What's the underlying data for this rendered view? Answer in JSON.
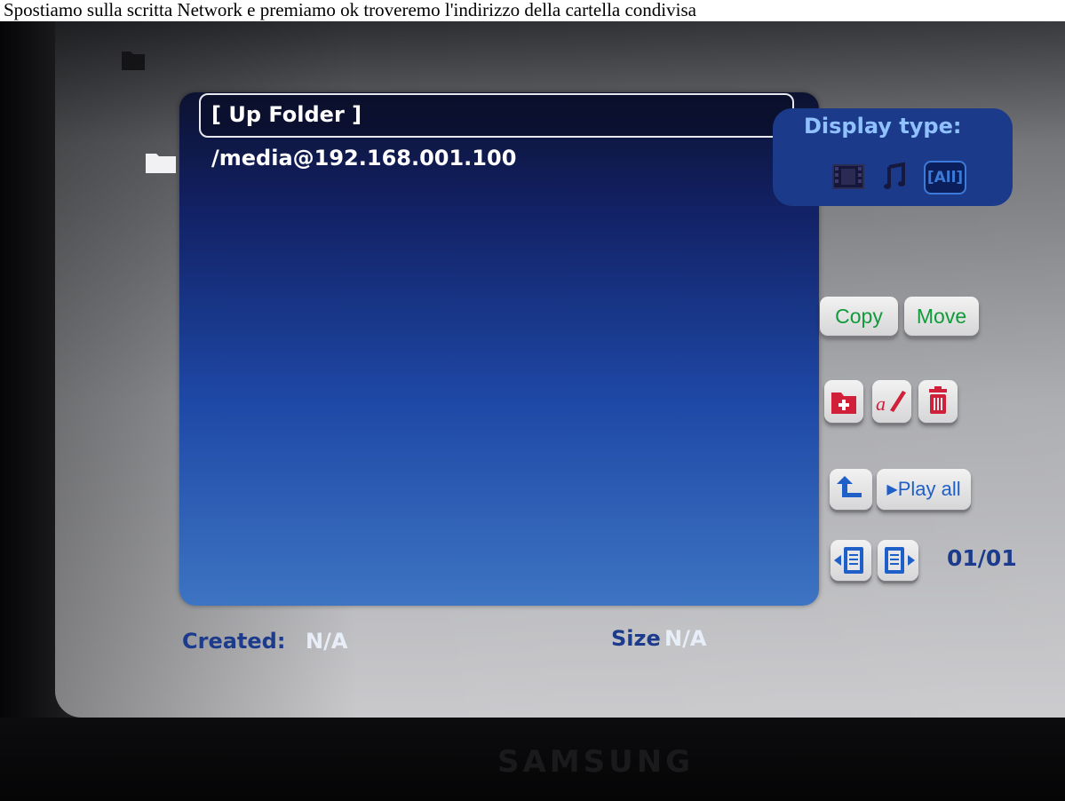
{
  "caption": "Spostiamo sulla scritta Network e premiamo ok troveremo l'indirizzo della cartella condivisa",
  "file_list": {
    "items": [
      {
        "label": "[ Up Folder ]",
        "selected": true
      },
      {
        "label": "/media@192.168.001.100",
        "icon": "folder-icon"
      }
    ]
  },
  "display_type": {
    "title": "Display type:",
    "options": [
      {
        "icon": "film-icon"
      },
      {
        "icon": "music-note-icon"
      },
      {
        "label": "[All]",
        "selected": true
      }
    ]
  },
  "actions": {
    "copy_label": "Copy",
    "move_label": "Move",
    "play_all_label": "Play all",
    "icons": [
      "new-folder-icon",
      "rename-icon",
      "delete-icon",
      "up-arrow-icon",
      "prev-page-icon",
      "next-page-icon"
    ]
  },
  "page_counter": "01/01",
  "info": {
    "created_label": "Created:",
    "created_value": "N/A",
    "size_label": "Size",
    "size_value": "N/A"
  },
  "brand": "SAMSUNG",
  "colors": {
    "panel_blue": "#1e48a6",
    "label_blue": "#1c3b8c",
    "button_green": "#119a3a",
    "icon_red": "#d0203a"
  }
}
